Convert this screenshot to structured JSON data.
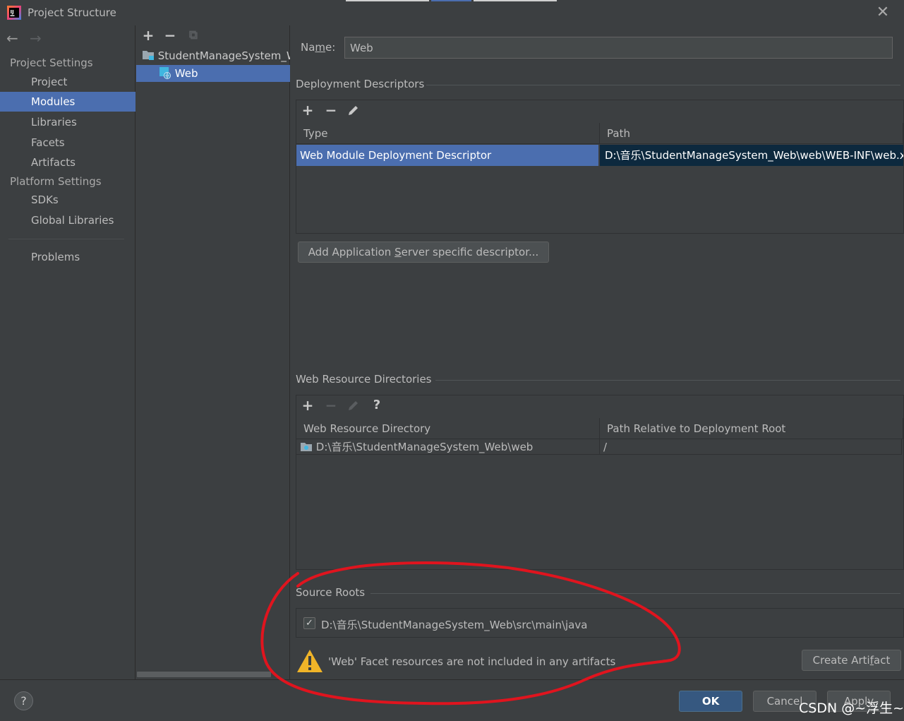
{
  "window": {
    "title": "Project Structure",
    "close_glyph": "✕"
  },
  "nav": {
    "back_glyph": "←",
    "forward_glyph": "→",
    "project_settings_label": "Project Settings",
    "project_items": [
      "Project",
      "Modules",
      "Libraries",
      "Facets",
      "Artifacts"
    ],
    "platform_settings_label": "Platform Settings",
    "platform_items": [
      "SDKs",
      "Global Libraries"
    ],
    "problems_label": "Problems",
    "selected": "Modules"
  },
  "tree": {
    "add_glyph": "+",
    "remove_glyph": "−",
    "copy_glyph": "⧉",
    "module_name": "StudentManageSystem_W",
    "facet_name": "Web"
  },
  "facet": {
    "name_label_pre": "Na",
    "name_label_mn": "m",
    "name_label_post": "e:",
    "name_value": "Web",
    "deployment_title": "Deployment Descriptors",
    "deployment_columns": [
      "Type",
      "Path"
    ],
    "deployment_rows": [
      {
        "type": "Web Module Deployment Descriptor",
        "path": "D:\\音乐\\StudentManageSystem_Web\\web\\WEB-INF\\web.xml"
      }
    ],
    "add_server_btn_pre": "Add Application ",
    "add_server_btn_mn": "S",
    "add_server_btn_post": "erver specific descriptor...",
    "resource_title": "Web Resource Directories",
    "resource_columns": [
      "Web Resource Directory",
      "Path Relative to Deployment Root"
    ],
    "resource_rows": [
      {
        "dir": "D:\\音乐\\StudentManageSystem_Web\\web",
        "rel": "/"
      }
    ],
    "help_glyph": "?",
    "source_roots_title": "Source Roots",
    "source_root_path": "D:\\音乐\\StudentManageSystem_Web\\src\\main\\java",
    "source_root_checked": true,
    "warning_text": "'Web' Facet resources are not included in any artifacts",
    "create_artifact_pre": "Create Arti",
    "create_artifact_mn": "f",
    "create_artifact_post": "act"
  },
  "footer": {
    "help_label": "?",
    "ok_label": "OK",
    "cancel_label": "Cancel",
    "apply_label": "Apply"
  },
  "watermark": "CSDN @~浮生~",
  "colors": {
    "background": "#3c3f41",
    "selection": "#4b6eaf",
    "default_button": "#365880",
    "annotation": "#e0141e",
    "warning": "#f0b428"
  }
}
